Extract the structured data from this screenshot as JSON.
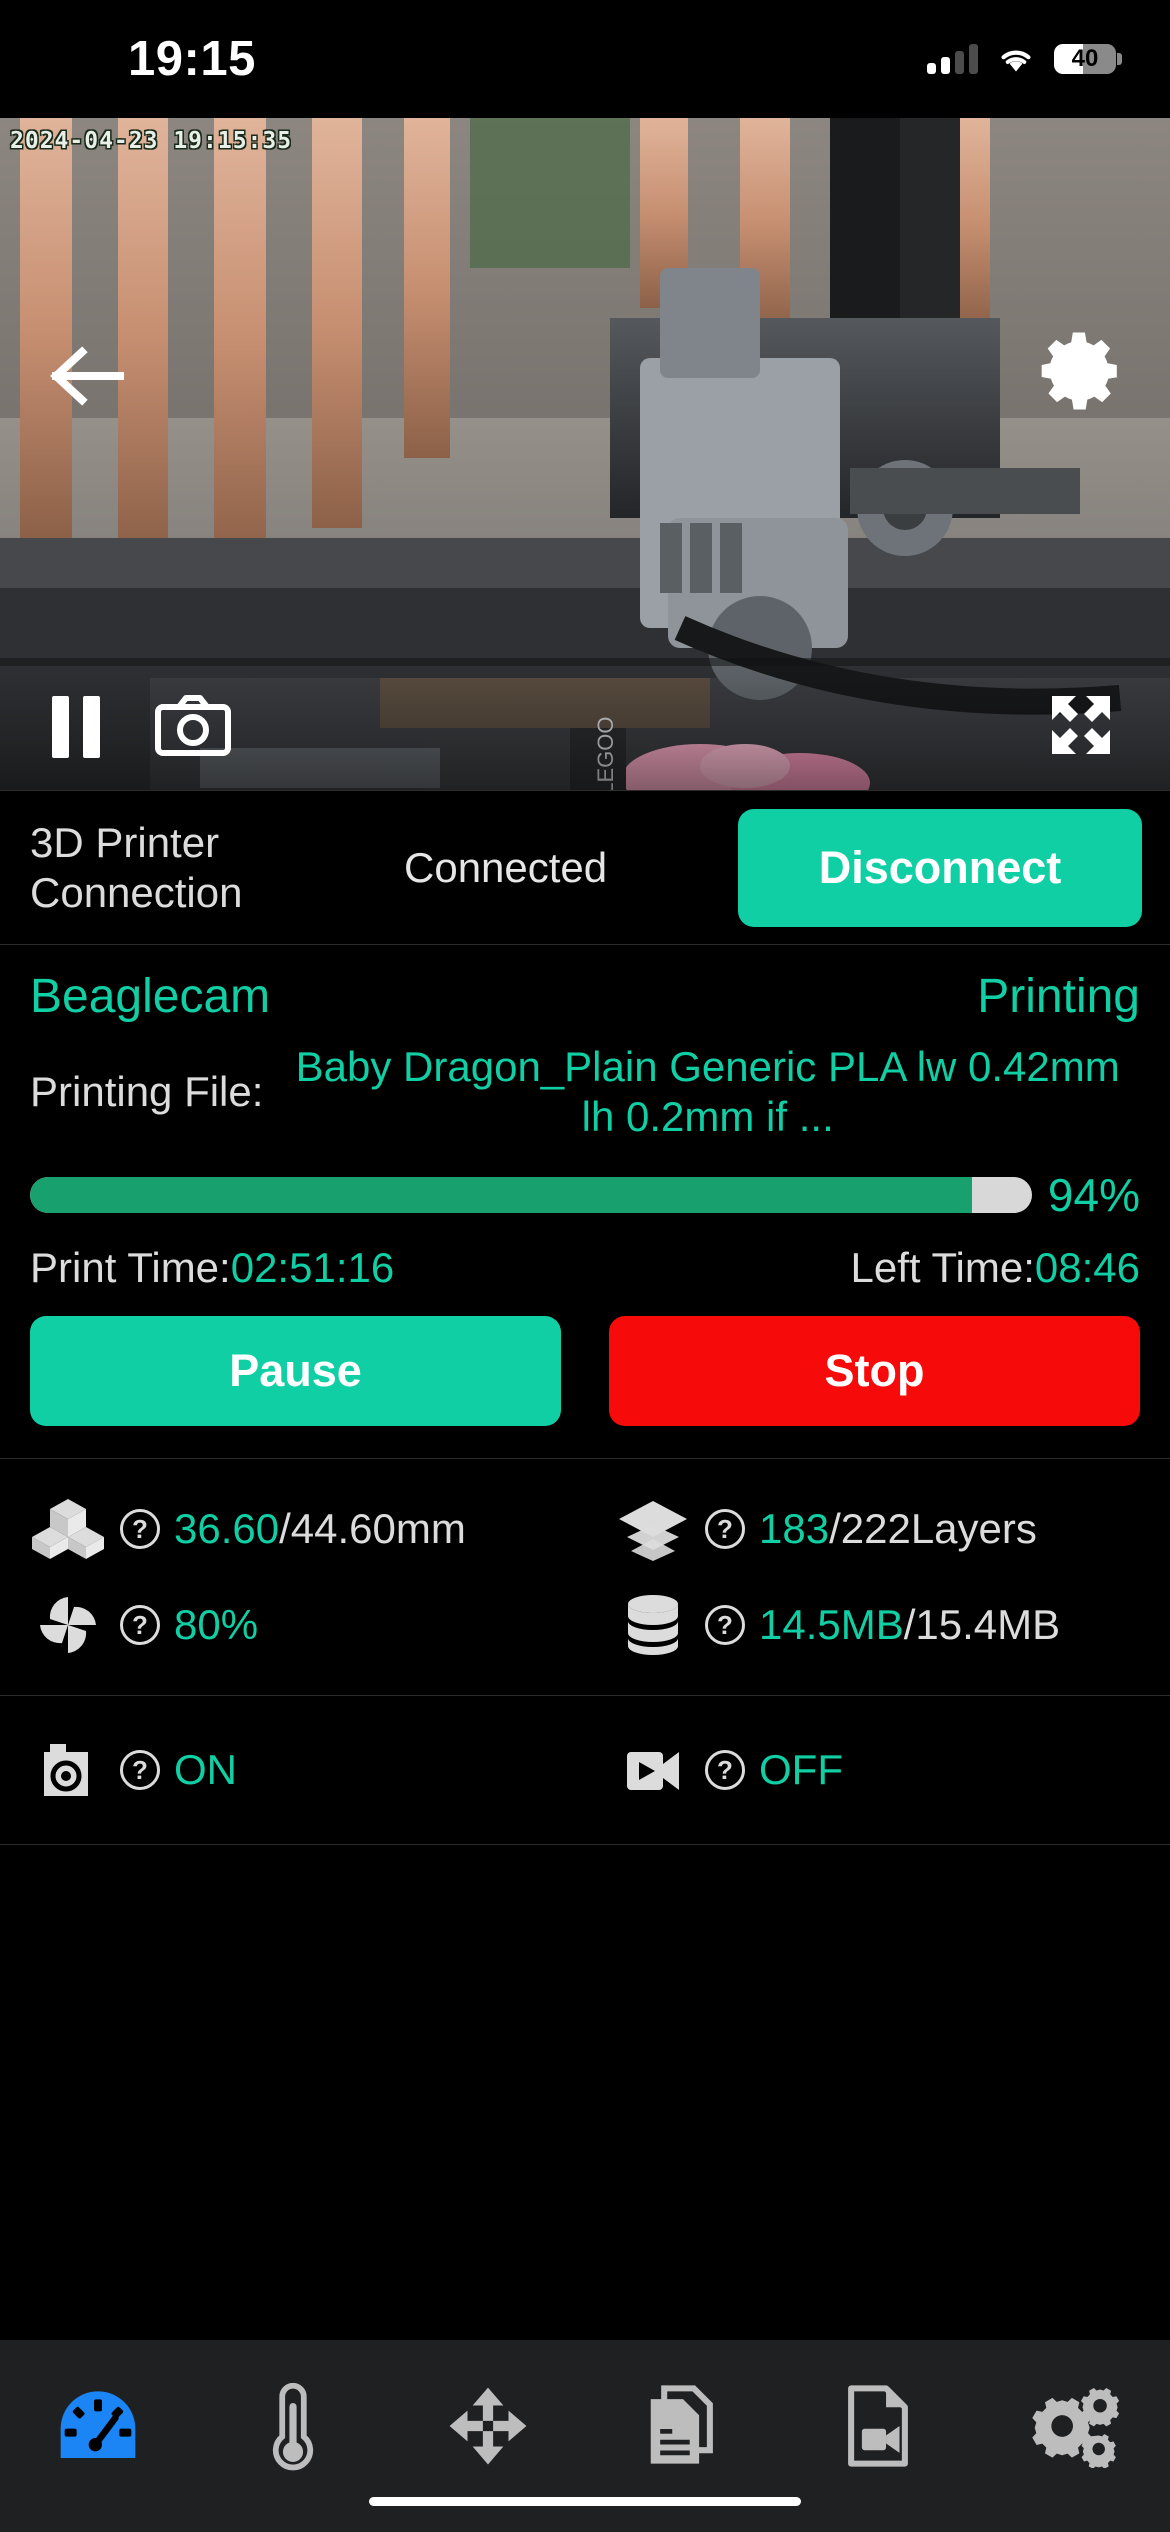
{
  "statusbar": {
    "time": "19:15",
    "battery_percent": "40",
    "signal_icon": "cellular-signal-icon",
    "wifi_icon": "wifi-icon",
    "battery_icon": "battery-icon"
  },
  "video": {
    "timestamp_overlay": "2024-04-23 19:15:35",
    "back_icon": "back-arrow-icon",
    "settings_icon": "gear-icon",
    "pause_icon": "pause-icon",
    "snapshot_icon": "camera-icon",
    "fullscreen_icon": "fullscreen-expand-icon"
  },
  "connection": {
    "label": "3D Printer Connection",
    "status": "Connected",
    "button_label": "Disconnect",
    "accent": "#11cfa5"
  },
  "print": {
    "printer_name": "Beaglecam",
    "state": "Printing",
    "file_label": "Printing File:",
    "file_name": "Baby Dragon_Plain Generic PLA lw 0.42mm lh 0.2mm if ...",
    "progress_percent": "94%",
    "progress_value": 94,
    "print_time_label": "Print Time:",
    "print_time_value": "02:51:16",
    "left_time_label": "Left Time:",
    "left_time_value": "08:46",
    "pause_label": "Pause",
    "stop_label": "Stop",
    "pause_color": "#11cfa5",
    "stop_color": "#f60a0a"
  },
  "stats": {
    "height": {
      "icon": "model-cubes-icon",
      "help": "?",
      "current": "36.60",
      "total": "/44.60mm"
    },
    "layers": {
      "icon": "layers-icon",
      "help": "?",
      "current": "183",
      "total": "/222Layers"
    },
    "fan": {
      "icon": "fan-icon",
      "help": "?",
      "current": "80%",
      "total": ""
    },
    "storage": {
      "icon": "database-icon",
      "help": "?",
      "current": "14.5MB",
      "total": "/15.4MB"
    }
  },
  "capture": {
    "photo": {
      "icon": "camera-icon",
      "help": "?",
      "value": "ON"
    },
    "video": {
      "icon": "video-camera-icon",
      "help": "?",
      "value": "OFF"
    }
  },
  "tabs": [
    {
      "name": "dashboard",
      "icon": "dashboard-gauge-icon",
      "active": true
    },
    {
      "name": "temperature",
      "icon": "thermometer-icon",
      "active": false
    },
    {
      "name": "move",
      "icon": "move-arrows-icon",
      "active": false
    },
    {
      "name": "files",
      "icon": "documents-icon",
      "active": false
    },
    {
      "name": "video-files",
      "icon": "video-file-icon",
      "active": false
    },
    {
      "name": "settings",
      "icon": "gears-icon",
      "active": false
    }
  ],
  "colors": {
    "accent": "#11cfa5",
    "progress": "#18a06f",
    "danger": "#f60a0a",
    "tab_active": "#1c85f5"
  }
}
